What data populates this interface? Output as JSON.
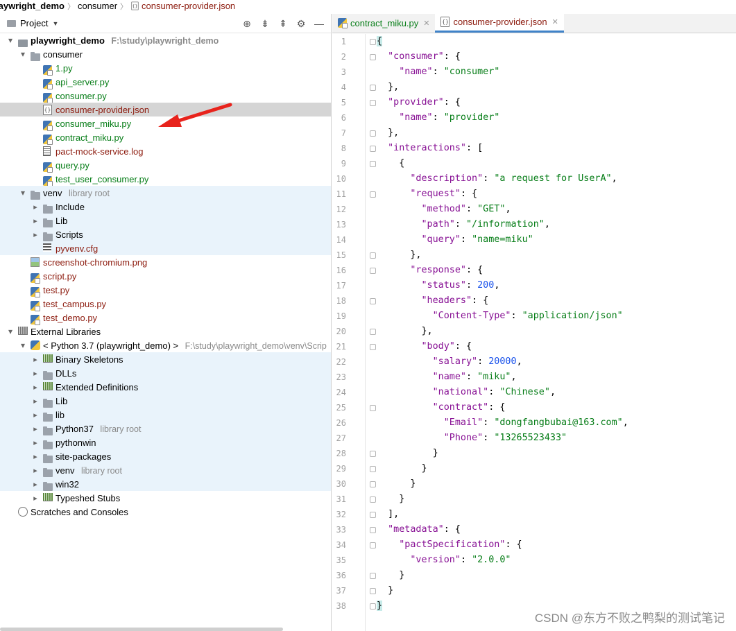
{
  "breadcrumb": [
    "laywright_demo",
    "consumer",
    "consumer-provider.json"
  ],
  "project_panel": {
    "title": "Project",
    "tree": [
      {
        "level": 0,
        "type": "project",
        "expanded": true,
        "label": "playwright_demo",
        "note": "F:\\study\\playwright_demo",
        "style": "bold"
      },
      {
        "level": 1,
        "type": "folder",
        "expanded": true,
        "label": "consumer"
      },
      {
        "level": 2,
        "type": "py",
        "label": "1.py",
        "style": "mod"
      },
      {
        "level": 2,
        "type": "py",
        "label": "api_server.py",
        "style": "mod"
      },
      {
        "level": 2,
        "type": "py",
        "label": "consumer.py",
        "style": "mod"
      },
      {
        "level": 2,
        "type": "json",
        "label": "consumer-provider.json",
        "style": "new",
        "selected": true
      },
      {
        "level": 2,
        "type": "py",
        "label": "consumer_miku.py",
        "style": "mod"
      },
      {
        "level": 2,
        "type": "py",
        "label": "contract_miku.py",
        "style": "mod"
      },
      {
        "level": 2,
        "type": "log",
        "label": "pact-mock-service.log",
        "style": "new"
      },
      {
        "level": 2,
        "type": "py",
        "label": "query.py",
        "style": "mod"
      },
      {
        "level": 2,
        "type": "py",
        "label": "test_user_consumer.py",
        "style": "mod"
      },
      {
        "level": 1,
        "type": "folder",
        "expanded": true,
        "label": "venv",
        "note": "library root",
        "lib": true
      },
      {
        "level": 2,
        "type": "folder",
        "expanded": false,
        "label": "Include",
        "lib": true
      },
      {
        "level": 2,
        "type": "folder",
        "expanded": false,
        "label": "Lib",
        "lib": true
      },
      {
        "level": 2,
        "type": "folder",
        "expanded": false,
        "label": "Scripts",
        "lib": true
      },
      {
        "level": 2,
        "type": "cfg",
        "label": "pyvenv.cfg",
        "style": "new",
        "lib": true
      },
      {
        "level": 1,
        "type": "png",
        "label": "screenshot-chromium.png",
        "style": "new"
      },
      {
        "level": 1,
        "type": "py",
        "label": "script.py",
        "style": "new"
      },
      {
        "level": 1,
        "type": "py",
        "label": "test.py",
        "style": "new"
      },
      {
        "level": 1,
        "type": "py",
        "label": "test_campus.py",
        "style": "new"
      },
      {
        "level": 1,
        "type": "py",
        "label": "test_demo.py",
        "style": "new"
      },
      {
        "level": 0,
        "type": "extlib",
        "expanded": true,
        "label": "External Libraries"
      },
      {
        "level": 1,
        "type": "pyenv",
        "expanded": true,
        "label": "< Python 3.7 (playwright_demo) >",
        "note": "F:\\study\\playwright_demo\\venv\\Scrip"
      },
      {
        "level": 2,
        "type": "libgreen",
        "expanded": false,
        "label": "Binary Skeletons",
        "lib": true
      },
      {
        "level": 2,
        "type": "folder",
        "expanded": false,
        "label": "DLLs",
        "lib": true
      },
      {
        "level": 2,
        "type": "libgreen",
        "expanded": false,
        "label": "Extended Definitions",
        "lib": true
      },
      {
        "level": 2,
        "type": "folder",
        "expanded": false,
        "label": "Lib",
        "lib": true
      },
      {
        "level": 2,
        "type": "folder",
        "expanded": false,
        "label": "lib",
        "lib": true
      },
      {
        "level": 2,
        "type": "folder",
        "expanded": false,
        "label": "Python37",
        "note": "library root",
        "lib": true
      },
      {
        "level": 2,
        "type": "folder",
        "expanded": false,
        "label": "pythonwin",
        "lib": true
      },
      {
        "level": 2,
        "type": "folder",
        "expanded": false,
        "label": "site-packages",
        "lib": true
      },
      {
        "level": 2,
        "type": "folder",
        "expanded": false,
        "label": "venv",
        "note": "library root",
        "lib": true
      },
      {
        "level": 2,
        "type": "folder",
        "expanded": false,
        "label": "win32",
        "lib": true
      },
      {
        "level": 2,
        "type": "libgreen",
        "expanded": false,
        "label": "Typeshed Stubs"
      },
      {
        "level": 0,
        "type": "scratch",
        "label": "Scratches and Consoles"
      }
    ]
  },
  "editor": {
    "tabs": [
      {
        "label": "contract_miku.py",
        "active": false
      },
      {
        "label": "consumer-provider.json",
        "active": true
      }
    ],
    "lines": [
      [
        [
          "br",
          "{"
        ]
      ],
      [
        [
          "p",
          "  "
        ],
        [
          "k",
          "\"consumer\""
        ],
        [
          "p",
          ": {"
        ]
      ],
      [
        [
          "p",
          "    "
        ],
        [
          "k",
          "\"name\""
        ],
        [
          "p",
          ": "
        ],
        [
          "s",
          "\"consumer\""
        ]
      ],
      [
        [
          "p",
          "  },"
        ]
      ],
      [
        [
          "p",
          "  "
        ],
        [
          "k",
          "\"provider\""
        ],
        [
          "p",
          ": {"
        ]
      ],
      [
        [
          "p",
          "    "
        ],
        [
          "k",
          "\"name\""
        ],
        [
          "p",
          ": "
        ],
        [
          "s",
          "\"provider\""
        ]
      ],
      [
        [
          "p",
          "  },"
        ]
      ],
      [
        [
          "p",
          "  "
        ],
        [
          "k",
          "\"interactions\""
        ],
        [
          "p",
          ": ["
        ]
      ],
      [
        [
          "p",
          "    {"
        ]
      ],
      [
        [
          "p",
          "      "
        ],
        [
          "k",
          "\"description\""
        ],
        [
          "p",
          ": "
        ],
        [
          "s",
          "\"a request for UserA\""
        ],
        [
          "p",
          ","
        ]
      ],
      [
        [
          "p",
          "      "
        ],
        [
          "k",
          "\"request\""
        ],
        [
          "p",
          ": {"
        ]
      ],
      [
        [
          "p",
          "        "
        ],
        [
          "k",
          "\"method\""
        ],
        [
          "p",
          ": "
        ],
        [
          "s",
          "\"GET\""
        ],
        [
          "p",
          ","
        ]
      ],
      [
        [
          "p",
          "        "
        ],
        [
          "k",
          "\"path\""
        ],
        [
          "p",
          ": "
        ],
        [
          "s",
          "\"/information\""
        ],
        [
          "p",
          ","
        ]
      ],
      [
        [
          "p",
          "        "
        ],
        [
          "k",
          "\"query\""
        ],
        [
          "p",
          ": "
        ],
        [
          "s",
          "\"name=miku\""
        ]
      ],
      [
        [
          "p",
          "      },"
        ]
      ],
      [
        [
          "p",
          "      "
        ],
        [
          "k",
          "\"response\""
        ],
        [
          "p",
          ": {"
        ]
      ],
      [
        [
          "p",
          "        "
        ],
        [
          "k",
          "\"status\""
        ],
        [
          "p",
          ": "
        ],
        [
          "n",
          "200"
        ],
        [
          "p",
          ","
        ]
      ],
      [
        [
          "p",
          "        "
        ],
        [
          "k",
          "\"headers\""
        ],
        [
          "p",
          ": {"
        ]
      ],
      [
        [
          "p",
          "          "
        ],
        [
          "k",
          "\"Content-Type\""
        ],
        [
          "p",
          ": "
        ],
        [
          "s",
          "\"application/json\""
        ]
      ],
      [
        [
          "p",
          "        },"
        ]
      ],
      [
        [
          "p",
          "        "
        ],
        [
          "k",
          "\"body\""
        ],
        [
          "p",
          ": {"
        ]
      ],
      [
        [
          "p",
          "          "
        ],
        [
          "k",
          "\"salary\""
        ],
        [
          "p",
          ": "
        ],
        [
          "n",
          "20000"
        ],
        [
          "p",
          ","
        ]
      ],
      [
        [
          "p",
          "          "
        ],
        [
          "k",
          "\"name\""
        ],
        [
          "p",
          ": "
        ],
        [
          "s",
          "\"miku\""
        ],
        [
          "p",
          ","
        ]
      ],
      [
        [
          "p",
          "          "
        ],
        [
          "k",
          "\"national\""
        ],
        [
          "p",
          ": "
        ],
        [
          "s",
          "\"Chinese\""
        ],
        [
          "p",
          ","
        ]
      ],
      [
        [
          "p",
          "          "
        ],
        [
          "k",
          "\"contract\""
        ],
        [
          "p",
          ": {"
        ]
      ],
      [
        [
          "p",
          "            "
        ],
        [
          "k",
          "\"Email\""
        ],
        [
          "p",
          ": "
        ],
        [
          "s",
          "\"dongfangbubai@163.com\""
        ],
        [
          "p",
          ","
        ]
      ],
      [
        [
          "p",
          "            "
        ],
        [
          "k",
          "\"Phone\""
        ],
        [
          "p",
          ": "
        ],
        [
          "s",
          "\"13265523433\""
        ]
      ],
      [
        [
          "p",
          "          }"
        ]
      ],
      [
        [
          "p",
          "        }"
        ]
      ],
      [
        [
          "p",
          "      }"
        ]
      ],
      [
        [
          "p",
          "    }"
        ]
      ],
      [
        [
          "p",
          "  ],"
        ]
      ],
      [
        [
          "p",
          "  "
        ],
        [
          "k",
          "\"metadata\""
        ],
        [
          "p",
          ": {"
        ]
      ],
      [
        [
          "p",
          "    "
        ],
        [
          "k",
          "\"pactSpecification\""
        ],
        [
          "p",
          ": {"
        ]
      ],
      [
        [
          "p",
          "      "
        ],
        [
          "k",
          "\"version\""
        ],
        [
          "p",
          ": "
        ],
        [
          "s",
          "\"2.0.0\""
        ]
      ],
      [
        [
          "p",
          "    }"
        ]
      ],
      [
        [
          "p",
          "  }"
        ]
      ],
      [
        [
          "br",
          "}"
        ]
      ]
    ],
    "fold_lines": [
      1,
      2,
      4,
      5,
      7,
      8,
      9,
      11,
      15,
      16,
      18,
      20,
      21,
      25,
      28,
      29,
      30,
      31,
      32,
      33,
      34,
      36,
      37,
      38
    ]
  },
  "watermark": "CSDN @东方不败之鸭梨的测试笔记",
  "colors": {
    "accent": "#4083c9",
    "modified": "#067d17",
    "new": "#8c1a0d",
    "key": "#871094",
    "number": "#1750eb",
    "lib_bg": "#e9f3fb",
    "selected_bg": "#d5d5d5"
  }
}
